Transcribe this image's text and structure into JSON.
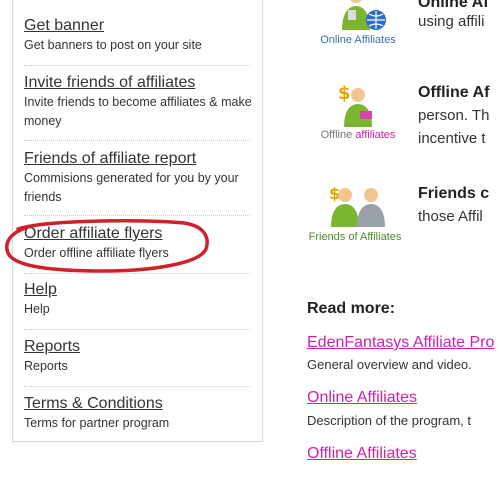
{
  "sidebar": {
    "items": [
      {
        "title": "Get banner",
        "desc": "Get banners to post on your site"
      },
      {
        "title": "Invite friends of affiliates",
        "desc": "Invite friends to become affiliates & make money"
      },
      {
        "title": "Friends of affiliate report",
        "desc": "Commisions generated for you by your friends"
      },
      {
        "title": "Order affiliate flyers",
        "desc": "Order offline affiliate flyers"
      },
      {
        "title": "Help",
        "desc": "Help"
      },
      {
        "title": "Reports",
        "desc": "Reports"
      },
      {
        "title": "Terms & Conditions",
        "desc": "Terms for partner program"
      }
    ]
  },
  "affiliates": [
    {
      "caption": "Online Affiliates",
      "heading": "Online Af",
      "lines": [
        "using affili"
      ]
    },
    {
      "caption_part1": "Offline ",
      "caption_part2": "affiliates",
      "heading": "Offline Af",
      "lines": [
        "person. Th",
        "incentive t"
      ]
    },
    {
      "caption": "Friends of Affiliates",
      "heading": "Friends c",
      "lines": [
        "those Affil"
      ]
    }
  ],
  "read_more": {
    "heading": "Read more:",
    "links": [
      {
        "label": "EdenFantasys Affiliate Pro",
        "desc": "General overview and video."
      },
      {
        "label": "Online Affiliates",
        "desc": "Description of the program, t"
      },
      {
        "label": "Offline Affiliates",
        "desc": ""
      }
    ]
  },
  "colors": {
    "link_magenta": "#cc22aa",
    "annotation_red": "#d0202a",
    "online_blue": "#3a6fb0",
    "friends_green": "#4d8a2a"
  }
}
